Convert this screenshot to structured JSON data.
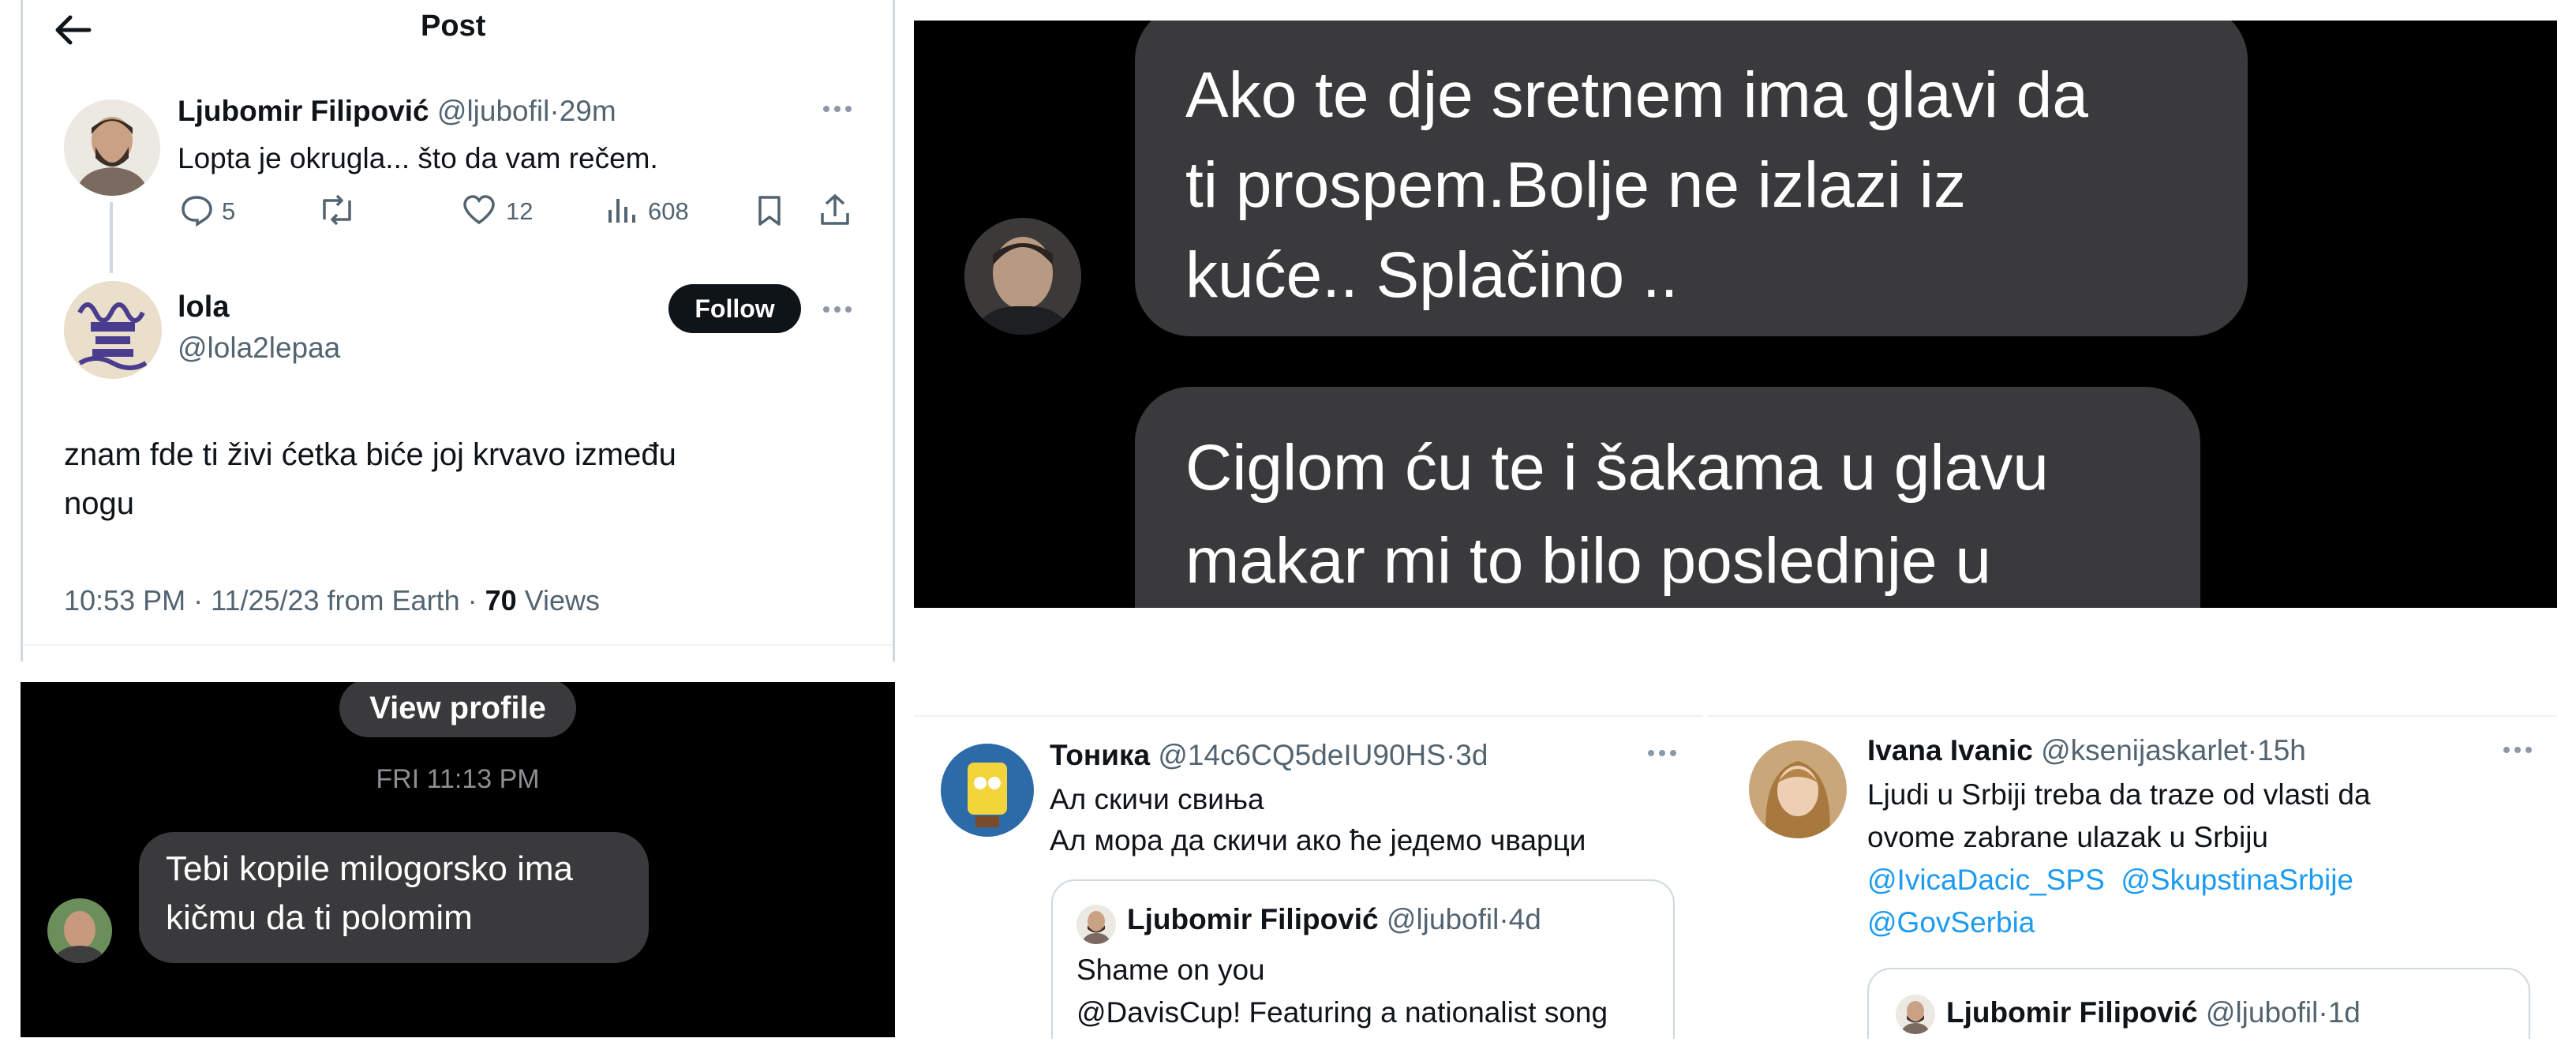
{
  "post": {
    "back_icon": "back-arrow-icon",
    "title": "Post",
    "tweet": {
      "author": "Ljubomir Filipović",
      "handle": "@ljubofil",
      "sep": "·",
      "time": "29m",
      "text": "Lopta je okrugla... što da vam rečem.",
      "replies": "5",
      "likes": "12",
      "views": "608"
    },
    "reply": {
      "author": "lola",
      "handle": "@lola2lepaa",
      "follow_label": "Follow",
      "text_line1": "znam fde ti živi ćetka biće joj krvavo između",
      "text_line2": "nogu",
      "meta_prefix": "10:53 PM · 11/25/23 from Earth · ",
      "views_count": "70",
      "views_label": " Views"
    }
  },
  "chat_top": {
    "bubble1": [
      "Ako te dje sretnem ima glavi da",
      "ti prospem.Bolje ne izlazi iz",
      "kuće.. Splačino .."
    ],
    "bubble2": [
      "Ciglom ću te i šakama u glavu",
      "makar mi to bilo poslednje u"
    ]
  },
  "chat_bottom": {
    "view_profile": "View profile",
    "timestamp": "FRI 11:13 PM",
    "bubble": [
      "Tebi kopile milogorsko ima",
      "kičmu da ti polomim"
    ]
  },
  "tweet_toni": {
    "author": "Тоника",
    "handle": "@14c6CQ5deIU90HS",
    "sep": "·",
    "time": "3d",
    "line1": "Ал скичи свиња",
    "line2": "Ал мора да скичи ако ће једемо чварци",
    "quote": {
      "author": "Ljubomir Filipović",
      "handle": "@ljubofil",
      "sep": "·",
      "time": "4d",
      "line1": "Shame on you",
      "line2": "@DavisCup! Featuring a nationalist song"
    }
  },
  "tweet_ivana": {
    "author": "Ivana Ivanic",
    "handle": "@ksenijaskarlet",
    "sep": "·",
    "time": "15h",
    "line1": "Ljudi u Srbiji treba da traze od vlasti da",
    "line2": "ovome  zabrane ulazak u Srbiju",
    "mention1": "@IvicaDacic_SPS",
    "mention2": "@SkupstinaSrbije",
    "mention3": "@GovSerbia",
    "quote": {
      "author": "Ljubomir Filipović",
      "handle": "@ljubofil",
      "sep": "·",
      "time": "1d"
    }
  },
  "colors": {
    "accent_link": "#1d9bf0",
    "text_grey": "#536471",
    "chat_bubble": "#3a3a3c",
    "dark_bg": "#000000"
  }
}
